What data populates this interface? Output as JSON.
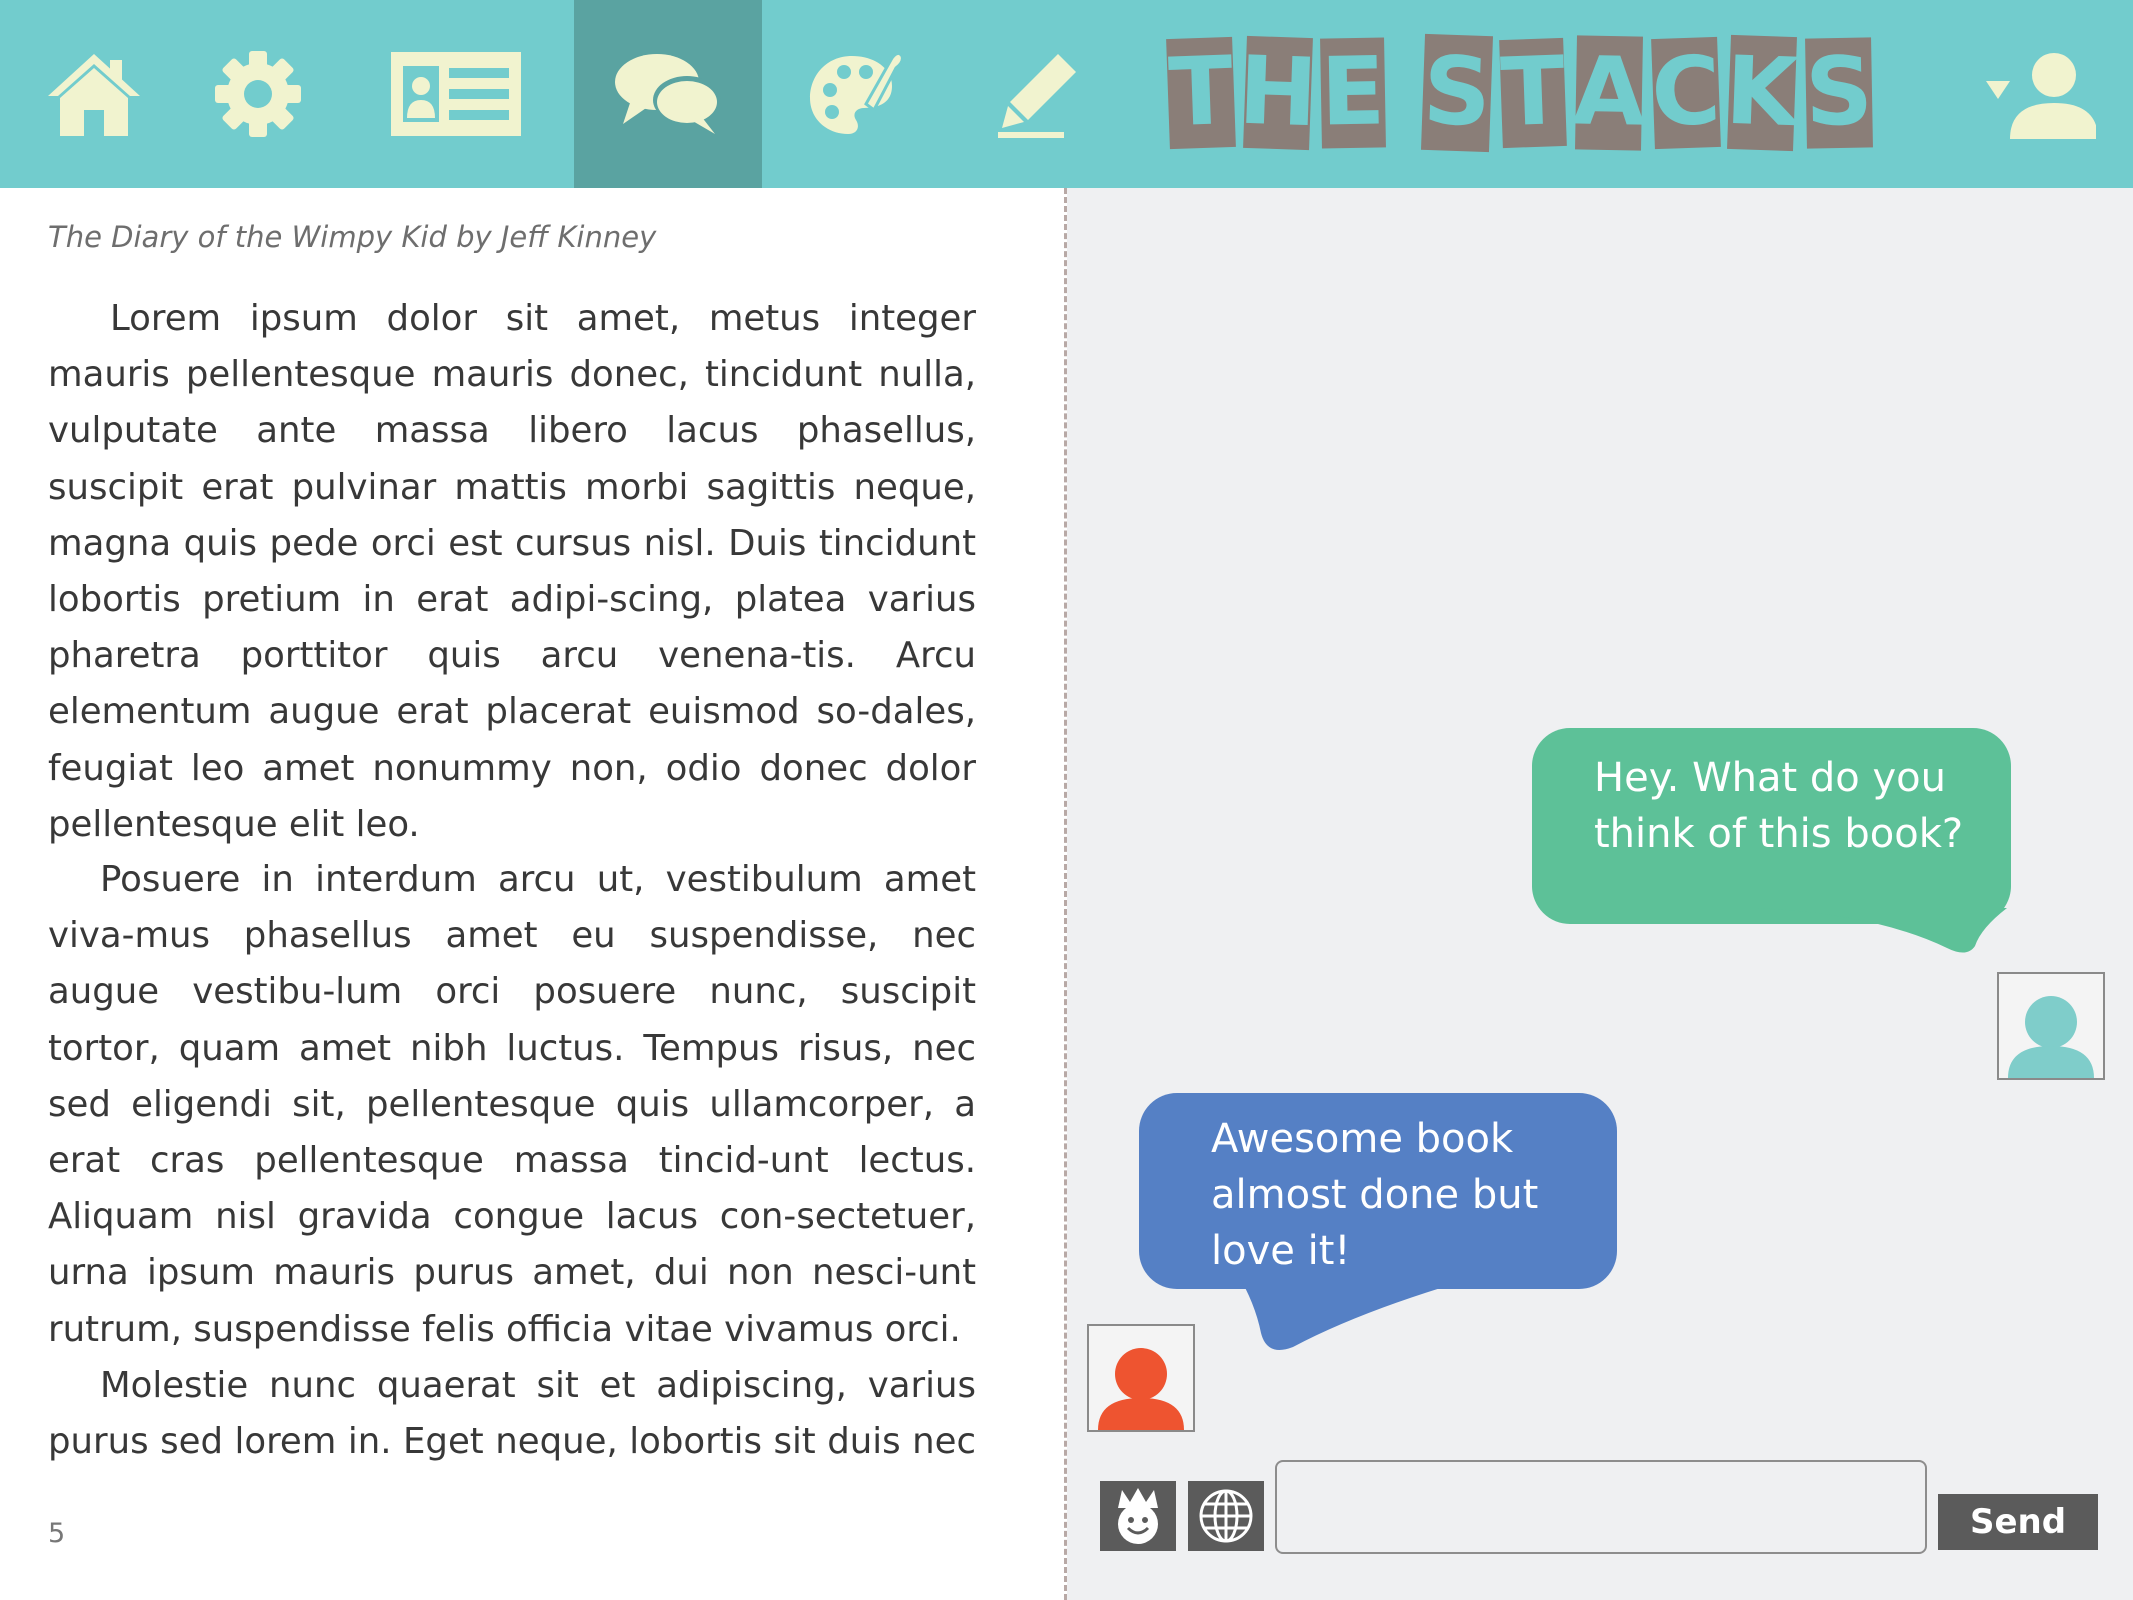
{
  "app": {
    "logo_text": "THE STACKS"
  },
  "nav": {
    "items": [
      {
        "icon": "home-icon",
        "active": false
      },
      {
        "icon": "gear-icon",
        "active": false
      },
      {
        "icon": "profile-card-icon",
        "active": false
      },
      {
        "icon": "chat-bubbles-icon",
        "active": true
      },
      {
        "icon": "palette-icon",
        "active": false
      },
      {
        "icon": "pencil-icon",
        "active": false
      }
    ],
    "user_menu_icon": "user-dropdown-icon"
  },
  "reader": {
    "book_title": "The Diary of the Wimpy Kid by Jeff Kinney",
    "paragraphs": [
      "Lorem ipsum dolor sit amet, metus integer mauris pellentesque mauris donec, tincidunt nulla, vulputate ante massa libero lacus phasellus, suscipit erat pulvinar mattis morbi sagittis neque, magna quis pede orci est cursus nisl. Duis tincidunt lobortis pretium in erat adipi-scing, platea varius pharetra porttitor quis arcu venena-tis. Arcu elementum augue erat placerat euismod so-dales, feugiat leo amet nonummy non, odio donec dolor pellentesque elit leo.",
      "Posuere in interdum arcu ut, vestibulum amet viva-mus phasellus amet eu suspendisse, nec augue vestibu-lum orci posuere nunc, suscipit tortor, quam amet nibh luctus. Tempus risus, nec sed eligendi sit, pellentesque quis ullamcorper, a erat cras pellentesque massa tincid-unt lectus. Aliquam nisl gravida congue lacus con-sectetuer, urna ipsum mauris purus amet, dui non nesci-unt rutrum, suspendisse felis officia vitae vivamus orci.",
      "Molestie nunc quaerat sit et adipiscing, varius purus sed lorem in. Eget neque, lobortis sit duis nec neque"
    ],
    "page_number": "5"
  },
  "chat": {
    "messages": [
      {
        "from": "friend",
        "text": "Hey. What do you think of this book?",
        "color": "#5dc198"
      },
      {
        "from": "me",
        "text": "Awesome book almost done but love it!",
        "color": "#5580c5"
      }
    ],
    "avatar_colors": {
      "friend": "#7fcdca",
      "me": "#ee5430"
    },
    "input_placeholder": "",
    "send_label": "Send"
  },
  "colors": {
    "topbar": "#72cccd",
    "topbar_active": "#5aa3a1",
    "icon": "#f1f3cf",
    "logo": "#8a7e78"
  }
}
